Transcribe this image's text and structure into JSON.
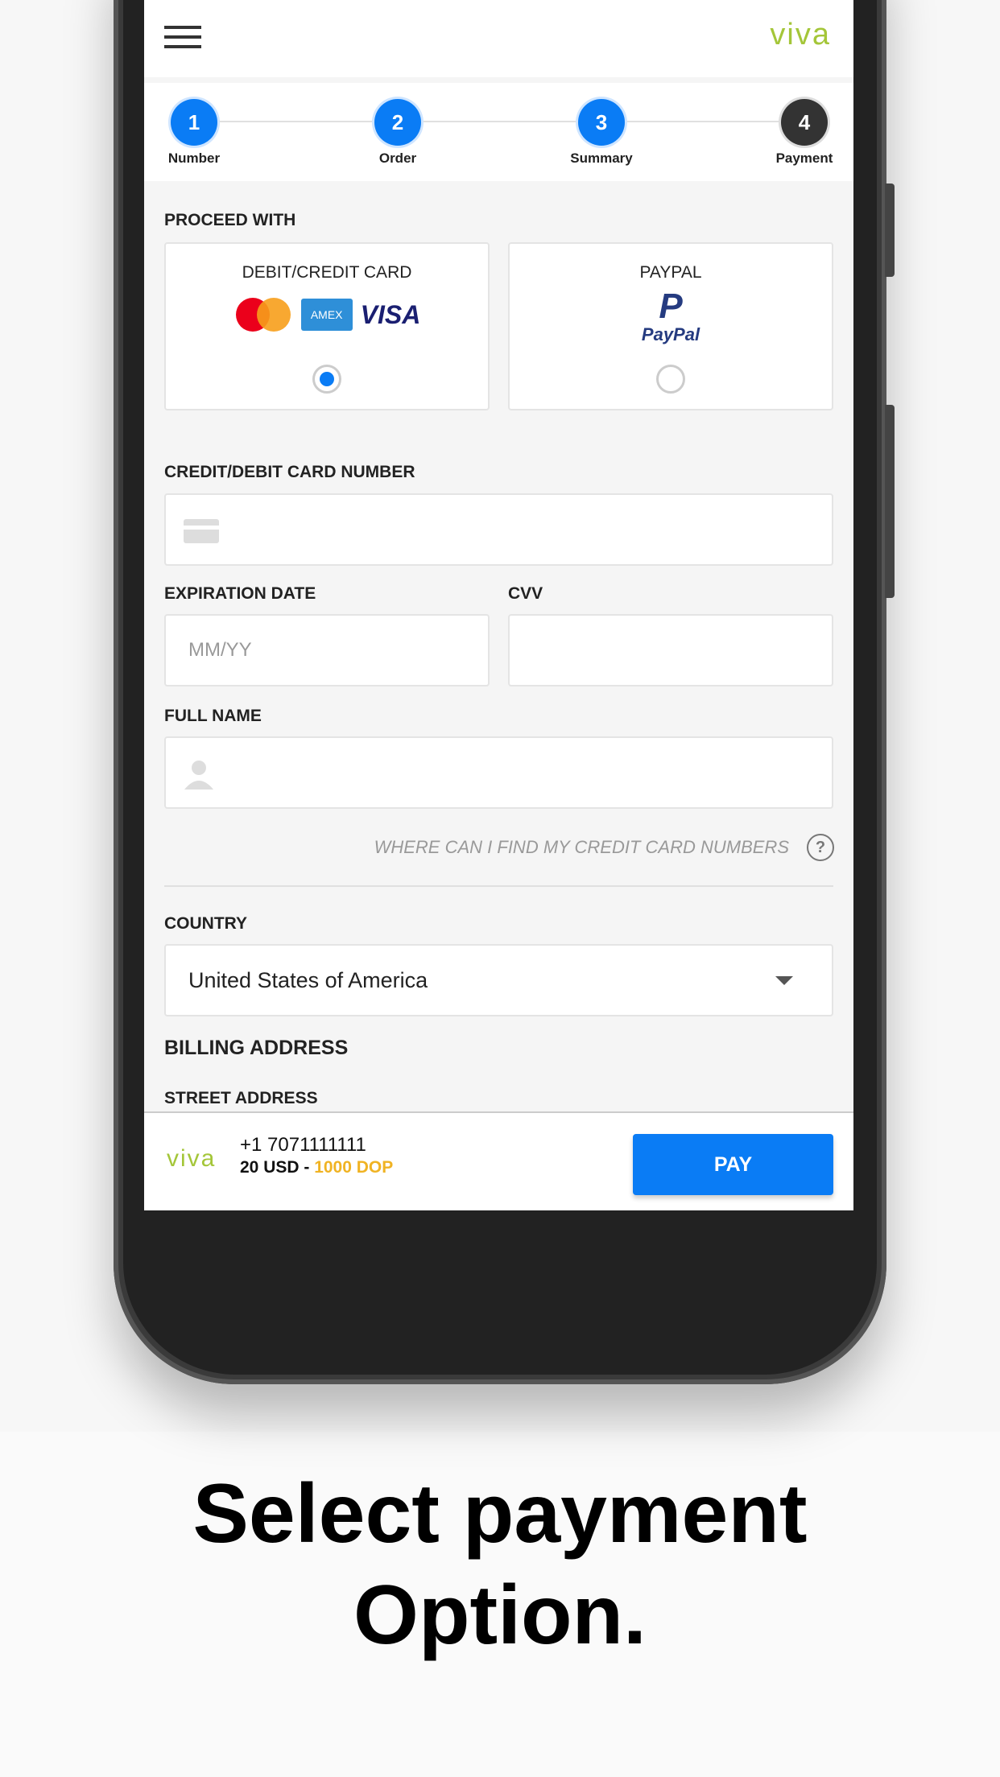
{
  "header": {
    "logo": "viva",
    "menu_icon": "hamburger-icon"
  },
  "stepper": [
    {
      "n": "1",
      "label": "Number",
      "state": "done"
    },
    {
      "n": "2",
      "label": "Order",
      "state": "done"
    },
    {
      "n": "3",
      "label": "Summary",
      "state": "done"
    },
    {
      "n": "4",
      "label": "Payment",
      "state": "current"
    }
  ],
  "colors": {
    "accent": "#0a7cf5",
    "brand": "#a4c639",
    "price": "#f0b323"
  },
  "form": {
    "proceed_with": "PROCEED WITH",
    "options": [
      {
        "label": "DEBIT/CREDIT CARD",
        "logos": [
          "MasterCard",
          "AMEX",
          "VISA"
        ],
        "selected": true
      },
      {
        "label": "PAYPAL",
        "logos": [
          "PayPal"
        ],
        "selected": false
      }
    ],
    "card_number_label": "CREDIT/DEBIT CARD NUMBER",
    "expiration_label": "EXPIRATION DATE",
    "expiration_placeholder": "MM/YY",
    "cvv_label": "CVV",
    "full_name_label": "FULL NAME",
    "help_text": "WHERE CAN I FIND MY CREDIT CARD NUMBERS",
    "help_icon": "?",
    "country_label": "COUNTRY",
    "country_value": "United States of America",
    "billing_address": "BILLING ADDRESS",
    "street_address": "STREET ADDRESS"
  },
  "footer": {
    "logo": "viva",
    "phone": "+1 7071111111",
    "amount": "20 USD - ",
    "amount_local": "1000 DOP",
    "pay": "PAY"
  },
  "caption": {
    "line1": "Select payment",
    "line2": "Option."
  }
}
